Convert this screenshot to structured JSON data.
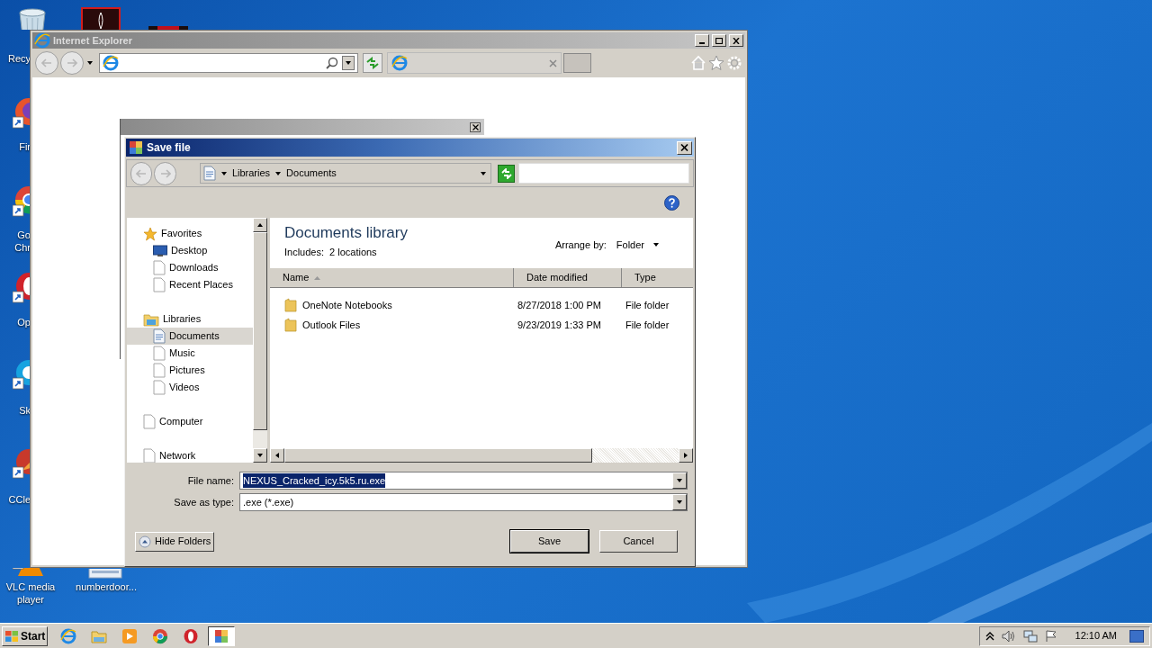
{
  "desktop_icons": [
    {
      "kind": "recycle",
      "lines": [
        "Recy"
      ]
    },
    {
      "kind": "firefox",
      "lines": [
        "Fir"
      ]
    },
    {
      "kind": "chrome",
      "lines": [
        "Go",
        "Chr"
      ]
    },
    {
      "kind": "opera",
      "lines": [
        "Op"
      ]
    },
    {
      "kind": "skype",
      "lines": [
        "Sk"
      ]
    },
    {
      "kind": "ccleaner",
      "lines": [
        "CCle"
      ]
    },
    {
      "kind": "vlc",
      "lines": [
        "VLC media",
        "player"
      ]
    },
    {
      "kind": "file",
      "lines": [
        "numberdoor..."
      ]
    }
  ],
  "ie_window": {
    "title": "Internet Explorer"
  },
  "dialog": {
    "title": "Save file",
    "breadcrumb": [
      "Libraries",
      "Documents"
    ],
    "library_title": "Documents library",
    "includes_label": "Includes:",
    "includes_value": "2 locations",
    "arrange_label": "Arrange by:",
    "arrange_value": "Folder",
    "nav": [
      {
        "label": "Favorites",
        "kind": "favorites",
        "selected": false,
        "children": [
          {
            "label": "Desktop",
            "kind": "desktop",
            "selected": false
          },
          {
            "label": "Downloads",
            "kind": "page",
            "selected": false
          },
          {
            "label": "Recent Places",
            "kind": "page",
            "selected": false
          }
        ]
      },
      {
        "label": "Libraries",
        "kind": "libraries",
        "selected": false,
        "children": [
          {
            "label": "Documents",
            "kind": "document",
            "selected": true
          },
          {
            "label": "Music",
            "kind": "page",
            "selected": false
          },
          {
            "label": "Pictures",
            "kind": "page",
            "selected": false
          },
          {
            "label": "Videos",
            "kind": "page",
            "selected": false
          }
        ]
      },
      {
        "label": "Computer",
        "kind": "page",
        "selected": false
      },
      {
        "label": "Network",
        "kind": "page",
        "selected": false
      }
    ],
    "columns": [
      {
        "label": "Name",
        "sorted": true
      },
      {
        "label": "Date modified",
        "sorted": false
      },
      {
        "label": "Type",
        "sorted": false
      }
    ],
    "rows": [
      {
        "name": "OneNote Notebooks",
        "date": "8/27/2018 1:00 PM",
        "type": "File folder"
      },
      {
        "name": "Outlook Files",
        "date": "9/23/2019 1:33 PM",
        "type": "File folder"
      }
    ],
    "file_name_label": "File name:",
    "file_name_value": "NEXUS_Cracked_icy.5k5.ru.exe",
    "file_name_selected": true,
    "save_type_label": "Save as type:",
    "save_type_value": ".exe (*.exe)",
    "hide_folders": "Hide Folders",
    "buttons": [
      {
        "label": "Save",
        "default": true
      },
      {
        "label": "Cancel",
        "default": false
      }
    ]
  },
  "taskbar": {
    "start": "Start",
    "clock": "12:10 AM",
    "apps": [
      {
        "kind": "ie",
        "selected": false
      },
      {
        "kind": "explorer",
        "selected": false
      },
      {
        "kind": "media",
        "selected": false
      },
      {
        "kind": "chrome",
        "selected": false
      },
      {
        "kind": "opera",
        "selected": false
      },
      {
        "kind": "dialog",
        "selected": true
      }
    ]
  }
}
